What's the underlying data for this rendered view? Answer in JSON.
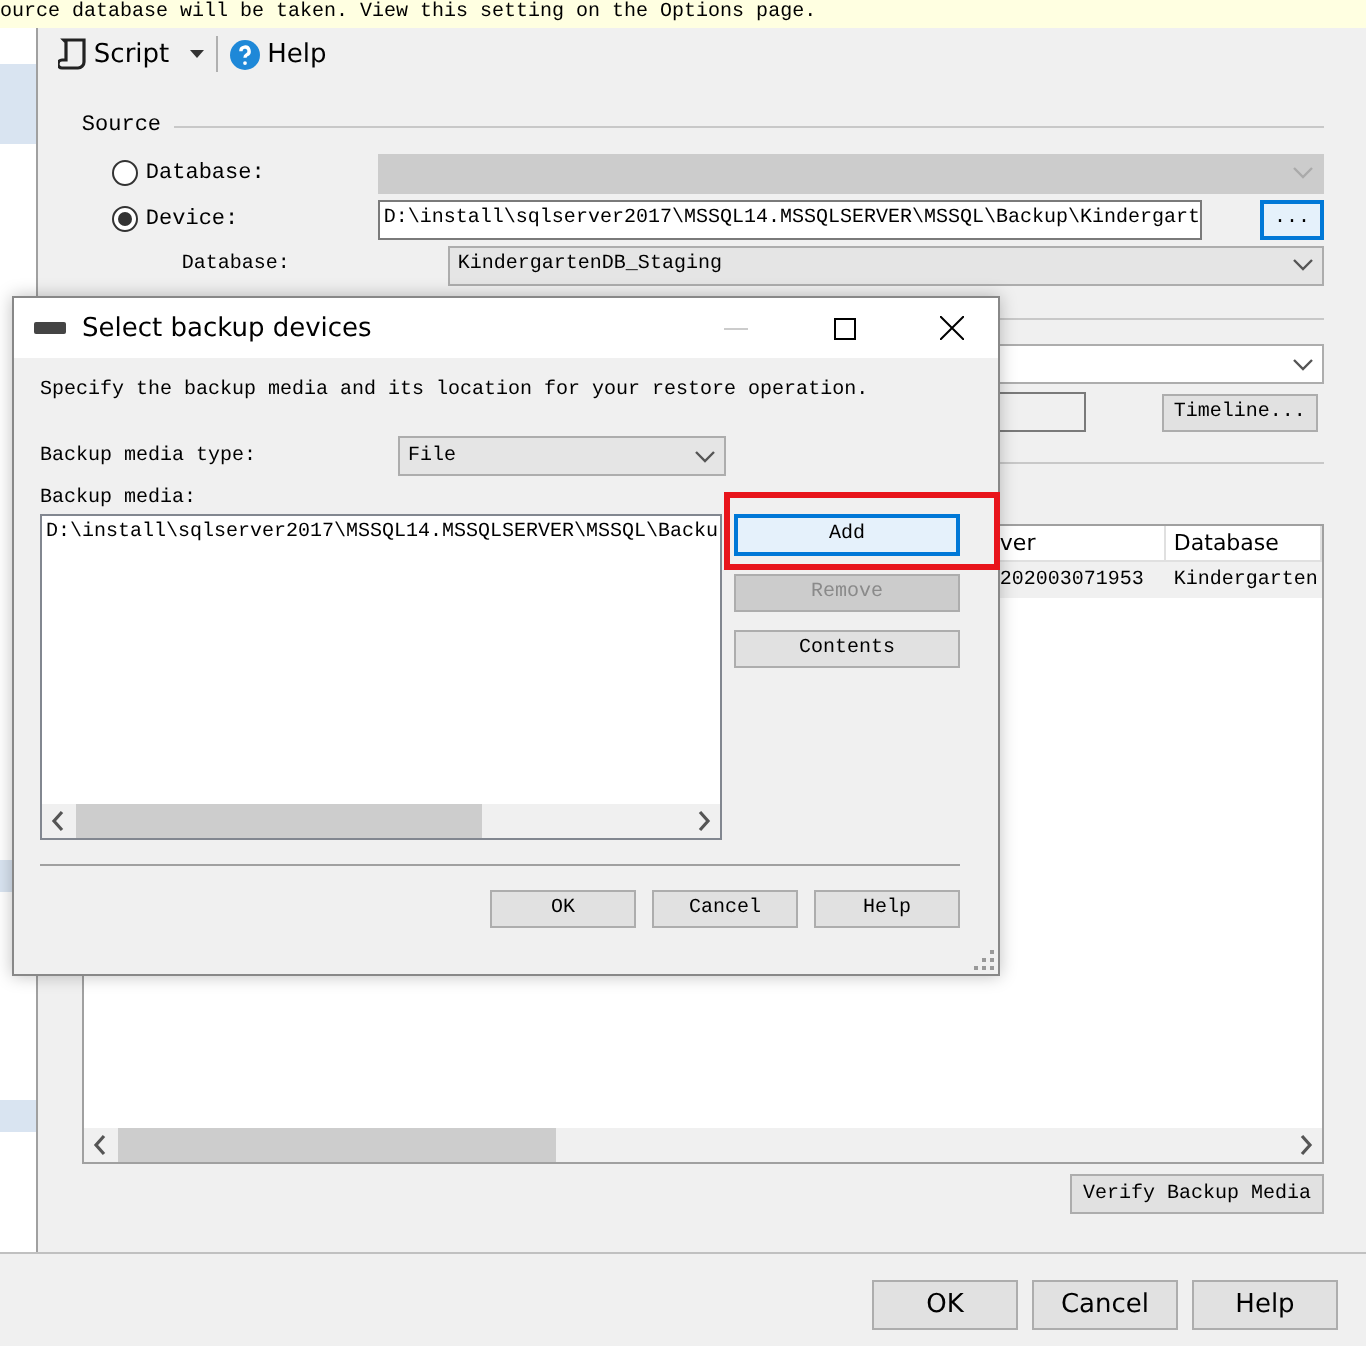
{
  "banner": "ource database will be taken. View this setting on the Options page.",
  "toolbar": [
    {
      "label": "Script",
      "kind": "script"
    },
    {
      "label": "Help",
      "kind": "help"
    }
  ],
  "source": {
    "title": "Source",
    "options": [
      {
        "label": "Database:",
        "kind": "database",
        "selected": false
      },
      {
        "label": "Device:",
        "kind": "device",
        "selected": true
      }
    ],
    "device_path": "D:\\install\\sqlserver2017\\MSSQL14.MSSQLSERVER\\MSSQL\\Backup\\Kindergart",
    "browse_button": "...",
    "database_label": "Database:",
    "database_value": "KindergartenDB_Staging"
  },
  "timeline_button": "Timeline...",
  "backup_grid": {
    "columns": [
      "ver",
      "Database"
    ],
    "rows": [
      {
        "cells": [
          "202003071953",
          "Kindergarten"
        ],
        "selected": true
      }
    ]
  },
  "verify_button": "Verify Backup Media",
  "buttons": [
    "OK",
    "Cancel",
    "Help"
  ],
  "dialog": {
    "title": "Select backup devices",
    "instructions": "Specify the backup media and its location for your restore operation.",
    "media_type_label": "Backup media type:",
    "media_type_value": "File",
    "media_label": "Backup media:",
    "media_items": [
      "D:\\install\\sqlserver2017\\MSSQL14.MSSQLSERVER\\MSSQL\\Backu"
    ],
    "side_buttons": [
      {
        "label": "Add",
        "disabled": false,
        "highlighted": true
      },
      {
        "label": "Remove",
        "disabled": true,
        "highlighted": false
      },
      {
        "label": "Contents",
        "disabled": false,
        "highlighted": false
      }
    ],
    "buttons": [
      "OK",
      "Cancel",
      "Help"
    ]
  }
}
